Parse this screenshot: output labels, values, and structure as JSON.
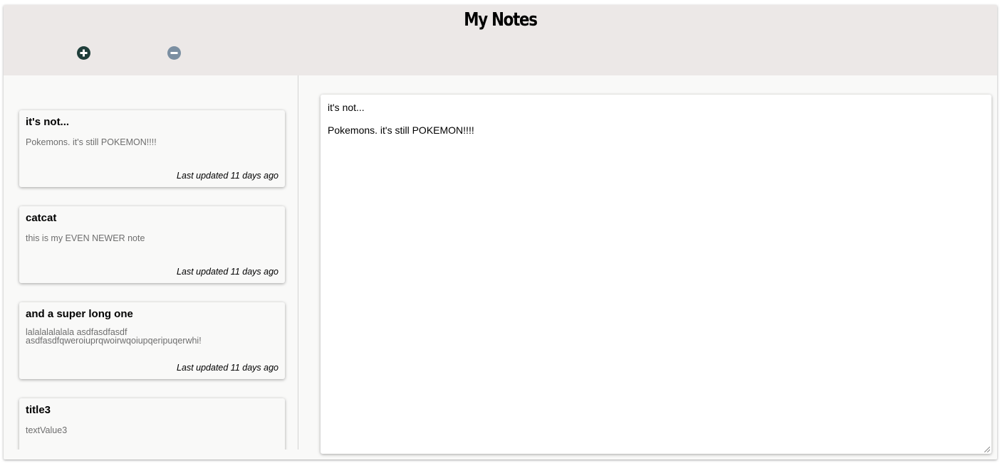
{
  "header": {
    "title": "My Notes",
    "add_icon": "plus-circle-icon",
    "remove_icon": "minus-circle-icon",
    "add_color": "#1f3e3a",
    "remove_color": "#7b8fa2"
  },
  "notes": [
    {
      "title": "it's not...",
      "preview": "Pokemons. it's still POKEMON!!!!",
      "updated": "Last updated 11 days ago"
    },
    {
      "title": "catcat",
      "preview": "this is my EVEN NEWER note",
      "updated": "Last updated 11 days ago"
    },
    {
      "title": "and a super long one",
      "preview_line1": "lalalalalalala asdfasdfasdf",
      "preview_line2": "asdfasdfqweroiuprqwoirwqoiupqeripuqerwhi!",
      "updated": "Last updated 11 days ago"
    },
    {
      "title": "title3",
      "preview": "textValue3"
    }
  ],
  "editor": {
    "title": "it's not...",
    "body": "Pokemons. it's still POKEMON!!!!"
  }
}
